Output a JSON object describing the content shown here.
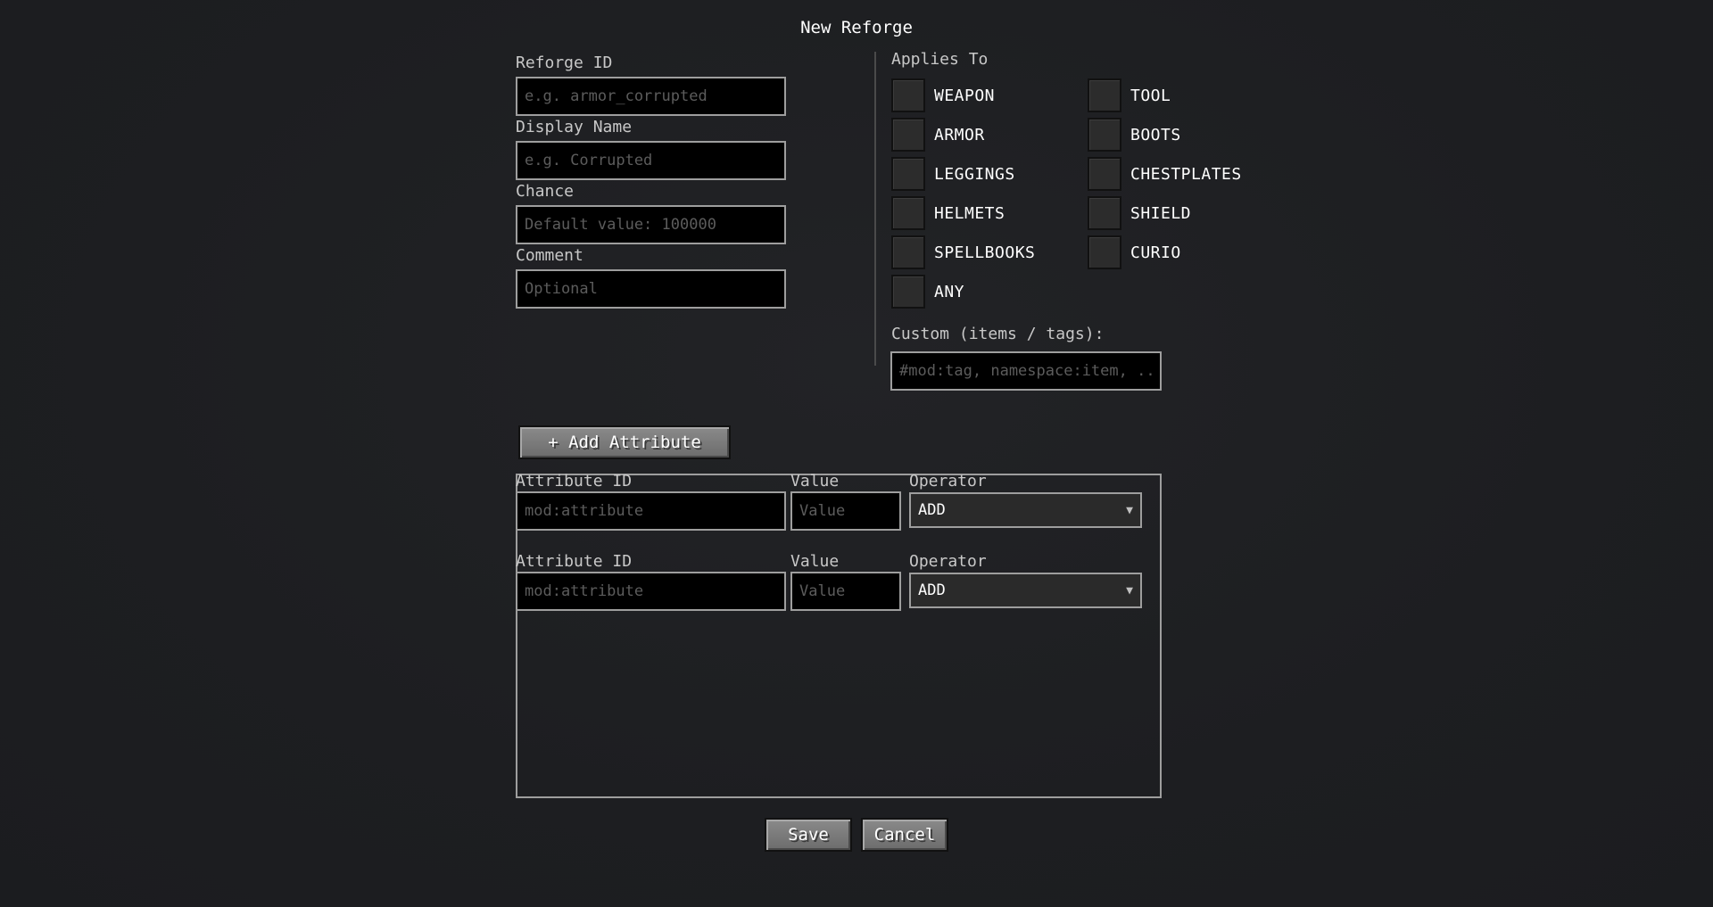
{
  "title": "New Reforge",
  "form": {
    "reforge_id": {
      "label": "Reforge ID",
      "value": "",
      "placeholder": "e.g. armor_corrupted"
    },
    "display_name": {
      "label": "Display Name",
      "value": "",
      "placeholder": "e.g. Corrupted"
    },
    "chance": {
      "label": "Chance",
      "value": "",
      "placeholder": "Default value: 100000"
    },
    "comment": {
      "label": "Comment",
      "value": "",
      "placeholder": "Optional"
    }
  },
  "applies_to": {
    "label": "Applies To",
    "options": [
      {
        "label": "WEAPON",
        "checked": false
      },
      {
        "label": "TOOL",
        "checked": false
      },
      {
        "label": "ARMOR",
        "checked": false
      },
      {
        "label": "BOOTS",
        "checked": false
      },
      {
        "label": "LEGGINGS",
        "checked": false
      },
      {
        "label": "CHESTPLATES",
        "checked": false
      },
      {
        "label": "HELMETS",
        "checked": false
      },
      {
        "label": "SHIELD",
        "checked": false
      },
      {
        "label": "SPELLBOOKS",
        "checked": false
      },
      {
        "label": "CURIO",
        "checked": false
      },
      {
        "label": "ANY",
        "checked": false
      }
    ],
    "custom_label": "Custom (items / tags):",
    "custom_placeholder": "#mod:tag, namespace:item, ..."
  },
  "add_attribute_label": "+ Add Attribute",
  "attributes": [
    {
      "id_label": "Attribute ID",
      "id_placeholder": "mod:attribute",
      "value_label": "Value",
      "value_placeholder": "Value",
      "operator_label": "Operator",
      "operator": "ADD"
    },
    {
      "id_label": "Attribute ID",
      "id_placeholder": "mod:attribute",
      "value_label": "Value",
      "value_placeholder": "Value",
      "operator_label": "Operator",
      "operator": "ADD"
    }
  ],
  "buttons": {
    "save": "Save",
    "cancel": "Cancel"
  }
}
